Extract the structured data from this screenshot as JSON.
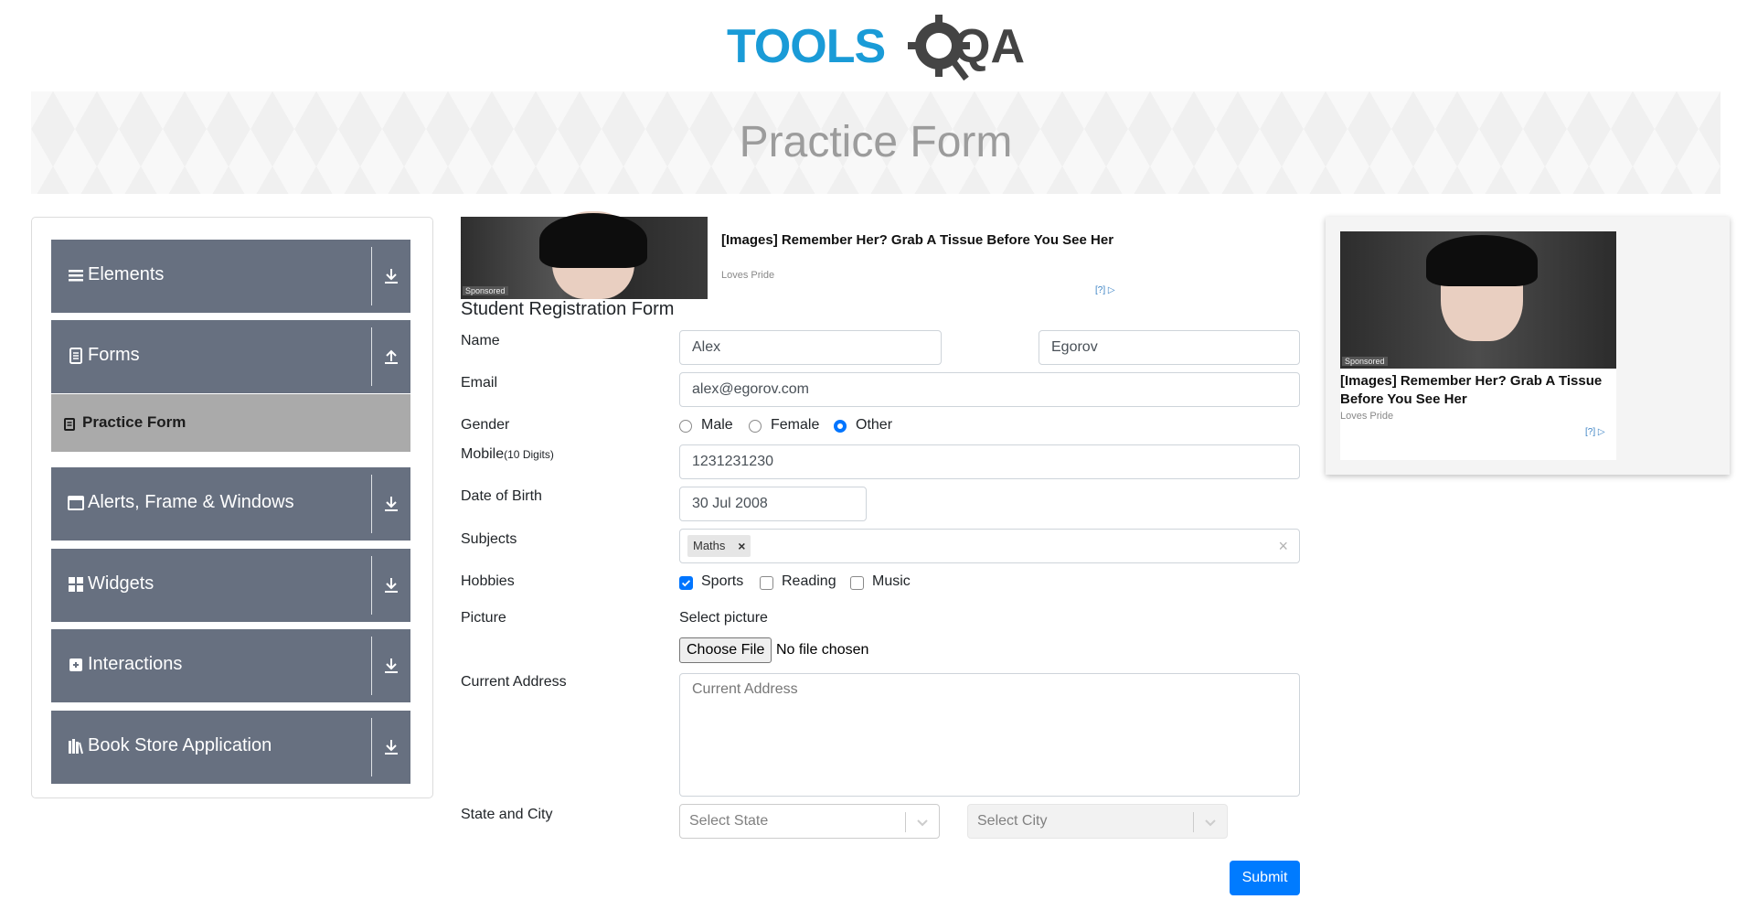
{
  "logo": {
    "text_tools": "TOOLS",
    "text_qa": "QA"
  },
  "banner": {
    "title": "Practice Form"
  },
  "sidebar": {
    "groups": [
      {
        "label": "Elements",
        "icon": "hamburger-icon",
        "state": "collapsed"
      },
      {
        "label": "Forms",
        "icon": "document-icon",
        "state": "expanded"
      },
      {
        "label": "Alerts, Frame & Windows",
        "icon": "window-icon",
        "state": "collapsed"
      },
      {
        "label": "Widgets",
        "icon": "widgets-icon",
        "state": "collapsed"
      },
      {
        "label": "Interactions",
        "icon": "interactions-icon",
        "state": "collapsed"
      },
      {
        "label": "Book Store Application",
        "icon": "books-icon",
        "state": "collapsed"
      }
    ],
    "active_item": {
      "label": "Practice Form"
    }
  },
  "top_ad": {
    "sponsored": "Sponsored",
    "title": "[Images] Remember Her? Grab A Tissue Before You See Her",
    "source": "Loves Pride",
    "choices": "[?]"
  },
  "form": {
    "title": "Student Registration Form",
    "name_label": "Name",
    "first_name": "Alex",
    "last_name": "Egorov",
    "email_label": "Email",
    "email": "alex@egorov.com",
    "gender_label": "Gender",
    "gender_options": [
      "Male",
      "Female",
      "Other"
    ],
    "gender_selected": "Other",
    "mobile_label": "Mobile",
    "mobile_hint": "(10 Digits)",
    "mobile": "1231231230",
    "dob_label": "Date of Birth",
    "dob": "30 Jul 2008",
    "subjects_label": "Subjects",
    "subjects": [
      "Maths"
    ],
    "hobbies_label": "Hobbies",
    "hobbies": [
      {
        "label": "Sports",
        "checked": true
      },
      {
        "label": "Reading",
        "checked": false
      },
      {
        "label": "Music",
        "checked": false
      }
    ],
    "picture_label": "Picture",
    "picture_hint": "Select picture",
    "choose_file": "Choose File",
    "no_file": "No file chosen",
    "address_label": "Current Address",
    "address_placeholder": "Current Address",
    "state_city_label": "State and City",
    "state_placeholder": "Select State",
    "city_placeholder": "Select City",
    "submit": "Submit"
  },
  "right_ad": {
    "sponsored": "Sponsored",
    "title": "[Images] Remember Her? Grab A Tissue Before You See Her",
    "source": "Loves Pride",
    "choices": "[?]"
  },
  "colors": {
    "accent": "#007bff",
    "sidebar": "#677080",
    "sidebar_active": "#aaaaaa",
    "radio": "#0075ff"
  }
}
